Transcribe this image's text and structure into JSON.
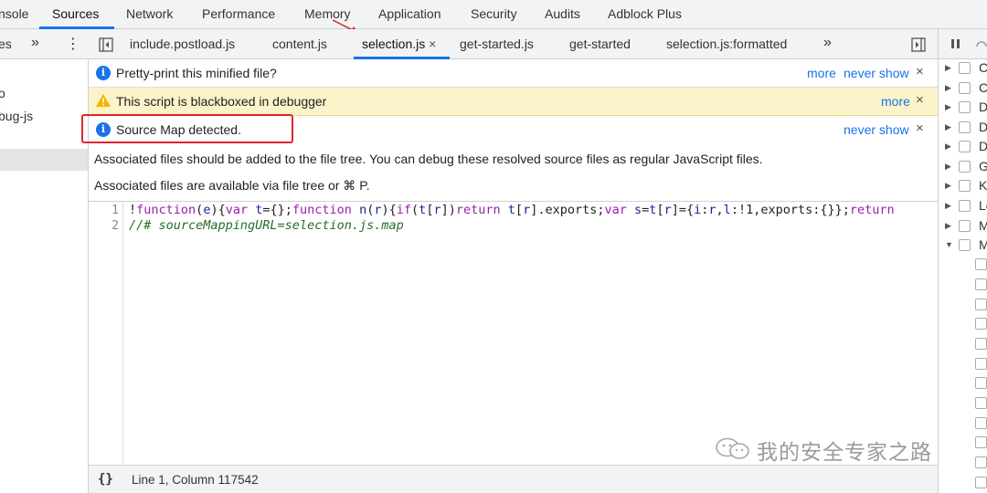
{
  "top_tabs": {
    "items": [
      {
        "label": "nsole"
      },
      {
        "label": "Sources"
      },
      {
        "label": "Network"
      },
      {
        "label": "Performance"
      },
      {
        "label": "Memory"
      },
      {
        "label": "Application"
      },
      {
        "label": "Security"
      },
      {
        "label": "Audits"
      },
      {
        "label": "Adblock Plus"
      }
    ],
    "active": "Sources"
  },
  "navigator": {
    "toolbar_label": "es",
    "more_glyph": "»",
    "menu_glyph": "⋮",
    "items": [
      {
        "label": "o"
      },
      {
        "label": "bug-js"
      }
    ]
  },
  "file_tabs": {
    "items": [
      {
        "label": "include.postload.js"
      },
      {
        "label": "content.js"
      },
      {
        "label": "selection.js"
      },
      {
        "label": "get-started.js"
      },
      {
        "label": "get-started"
      },
      {
        "label": "selection.js:formatted"
      }
    ],
    "active": "selection.js",
    "close_glyph": "×",
    "overflow_glyph": "»"
  },
  "infobars": {
    "pretty_print": {
      "message": "Pretty-print this minified file?",
      "more": "more",
      "never_show": "never show"
    },
    "blackboxed": {
      "message": "This script is blackboxed in debugger",
      "more": "more"
    },
    "source_map": {
      "message": "Source Map detected.",
      "never_show": "never show",
      "detail_1": "Associated files should be added to the file tree. You can debug these resolved source files as regular JavaScript files.",
      "detail_2": "Associated files are available via file tree or ⌘ P."
    },
    "close_glyph": "×"
  },
  "editor": {
    "line_numbers": [
      "1",
      "2"
    ],
    "line_1": "!function(e){var t={};function n(r){if(t[r])return t[r].exports;var s=t[r]={i:r,l:!1,exports:{}};return",
    "line_2": "//# sourceMappingURL=selection.js.map"
  },
  "status_bar": {
    "format_glyph": "{}",
    "cursor_position": "Line 1, Column 117542"
  },
  "watermark": {
    "text": "我的安全专家之路"
  },
  "right_pane": {
    "breakpoint_rows": [
      {
        "label": "C",
        "expanded": false
      },
      {
        "label": "C",
        "expanded": false
      },
      {
        "label": "D",
        "expanded": false
      },
      {
        "label": "D",
        "expanded": false
      },
      {
        "label": "D",
        "expanded": false
      },
      {
        "label": "G",
        "expanded": false
      },
      {
        "label": "K",
        "expanded": false
      },
      {
        "label": "Le",
        "expanded": false
      },
      {
        "label": "M",
        "expanded": false
      },
      {
        "label": "M",
        "expanded": true
      }
    ]
  },
  "colors": {
    "accent": "#1a73e8",
    "warning_bg": "#fbf3c9",
    "highlight_box": "#e0242b"
  }
}
